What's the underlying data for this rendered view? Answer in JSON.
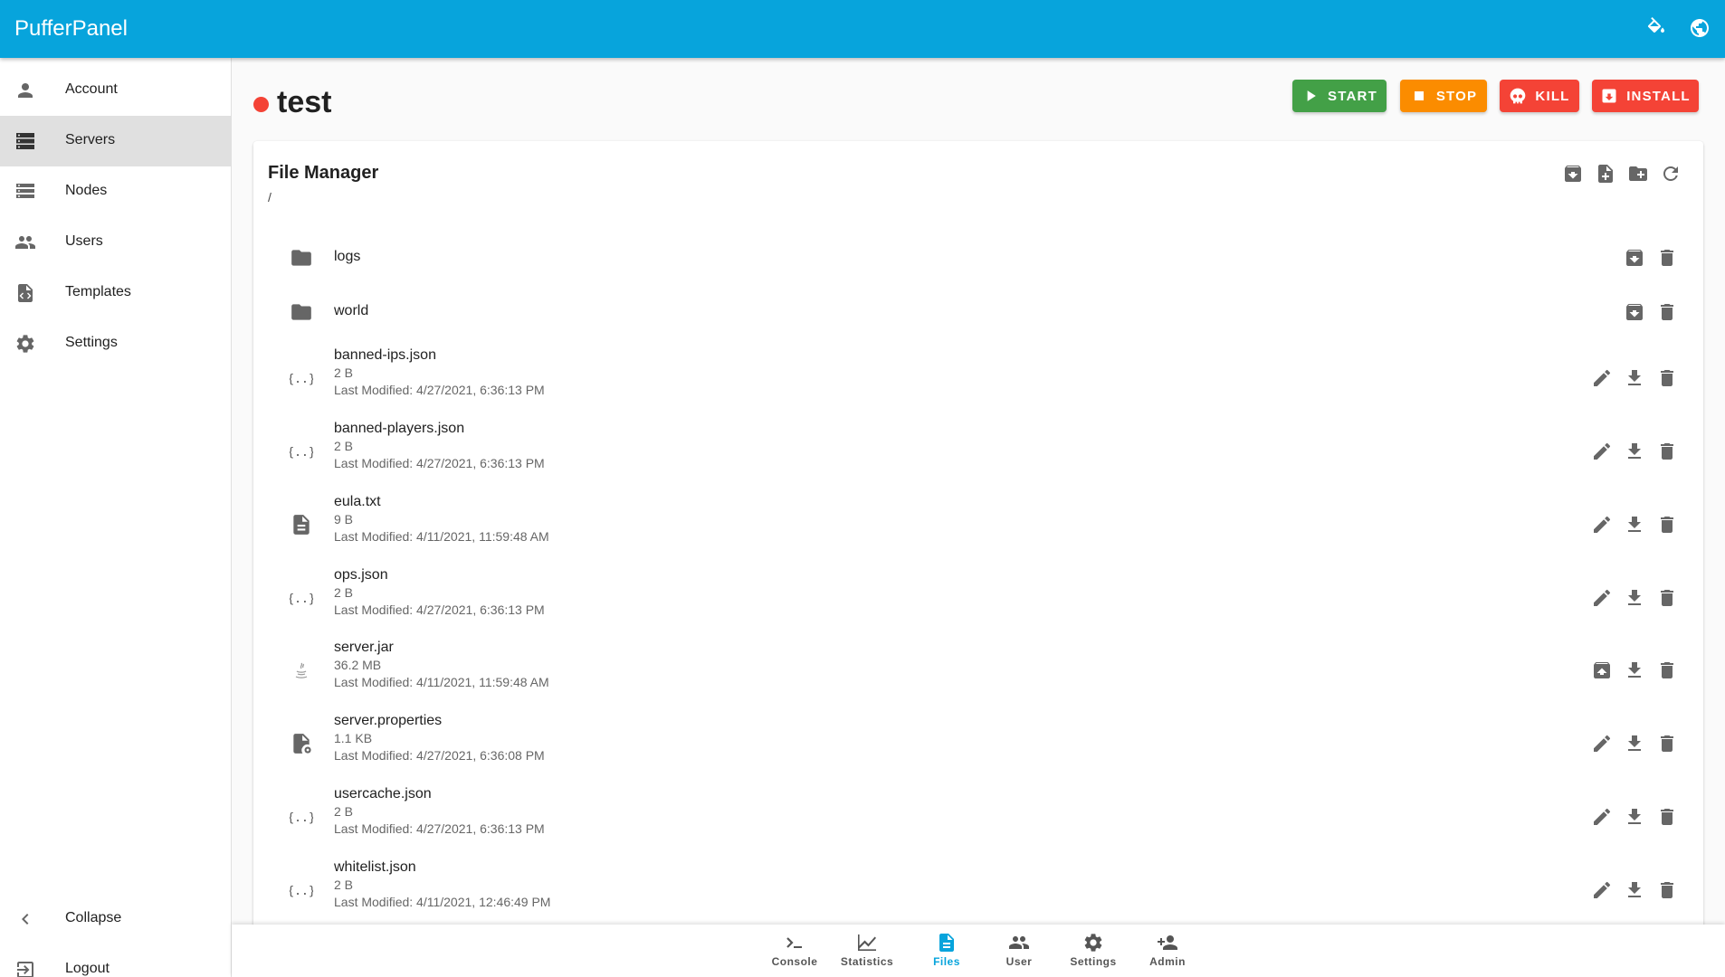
{
  "app": {
    "title": "PufferPanel",
    "accent": "#07a4dc"
  },
  "topbar": {
    "icons": [
      "theme-paint-icon",
      "language-globe-icon"
    ]
  },
  "sidebar": {
    "items": [
      {
        "label": "Account",
        "icon": "account-icon"
      },
      {
        "label": "Servers",
        "icon": "servers-icon",
        "active": true
      },
      {
        "label": "Nodes",
        "icon": "nodes-icon"
      },
      {
        "label": "Users",
        "icon": "users-icon"
      },
      {
        "label": "Templates",
        "icon": "templates-icon"
      },
      {
        "label": "Settings",
        "icon": "settings-icon"
      }
    ],
    "collapse_label": "Collapse",
    "logout_label": "Logout"
  },
  "server": {
    "name": "test",
    "status_color": "#f44336"
  },
  "actions": {
    "start": {
      "label": "START",
      "color": "#43a047"
    },
    "stop": {
      "label": "STOP",
      "color": "#fb8c00"
    },
    "kill": {
      "label": "KILL",
      "color": "#f44336"
    },
    "install": {
      "label": "INSTALL",
      "color": "#f44336"
    }
  },
  "file_manager": {
    "title": "File Manager",
    "path": "/",
    "toolbar_icons": [
      "archive-download-icon",
      "new-file-icon",
      "new-folder-icon",
      "refresh-icon"
    ],
    "files": [
      {
        "name": "logs",
        "type": "folder"
      },
      {
        "name": "world",
        "type": "folder"
      },
      {
        "name": "banned-ips.json",
        "type": "json",
        "size": "2 B",
        "modified": "Last Modified: 4/27/2021, 6:36:13 PM"
      },
      {
        "name": "banned-players.json",
        "type": "json",
        "size": "2 B",
        "modified": "Last Modified: 4/27/2021, 6:36:13 PM"
      },
      {
        "name": "eula.txt",
        "type": "text",
        "size": "9 B",
        "modified": "Last Modified: 4/11/2021, 11:59:48 AM"
      },
      {
        "name": "ops.json",
        "type": "json",
        "size": "2 B",
        "modified": "Last Modified: 4/27/2021, 6:36:13 PM"
      },
      {
        "name": "server.jar",
        "type": "jar",
        "size": "36.2 MB",
        "modified": "Last Modified: 4/11/2021, 11:59:48 AM"
      },
      {
        "name": "server.properties",
        "type": "properties",
        "size": "1.1 KB",
        "modified": "Last Modified: 4/27/2021, 6:36:08 PM"
      },
      {
        "name": "usercache.json",
        "type": "json",
        "size": "2 B",
        "modified": "Last Modified: 4/27/2021, 6:36:13 PM"
      },
      {
        "name": "whitelist.json",
        "type": "json",
        "size": "2 B",
        "modified": "Last Modified: 4/11/2021, 12:46:49 PM"
      }
    ]
  },
  "bottom_nav": {
    "items": [
      {
        "label": "Console",
        "icon": "console-icon"
      },
      {
        "label": "Statistics",
        "icon": "statistics-icon"
      },
      {
        "label": "Files",
        "icon": "files-icon",
        "active": true
      },
      {
        "label": "User",
        "icon": "user-icon"
      },
      {
        "label": "Settings",
        "icon": "settings-icon"
      },
      {
        "label": "Admin",
        "icon": "admin-icon"
      }
    ]
  }
}
